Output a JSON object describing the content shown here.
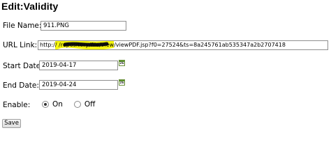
{
  "page": {
    "title": "Edit:Validity"
  },
  "form": {
    "file_name": {
      "label": "File Name:",
      "value": "911.PNG"
    },
    "url_link": {
      "label": "URL Link:",
      "value": "http:// /repository/file/view/viewPDF.jsp?f0=27524&ts=8a245761ab535347a2b2707418",
      "redaction_color": "#f5f500"
    },
    "start_date": {
      "label": "Start Date:",
      "value": "2019-04-17",
      "calendar_icon": "calendar-icon",
      "calendar_day": "26"
    },
    "end_date": {
      "label": "End Date:",
      "value": "2019-04-24",
      "calendar_icon": "calendar-icon",
      "calendar_day": "26"
    },
    "enable": {
      "label": "Enable:",
      "options": [
        {
          "label": "On",
          "selected": true
        },
        {
          "label": "Off",
          "selected": false
        }
      ]
    },
    "save_label": "Save"
  }
}
